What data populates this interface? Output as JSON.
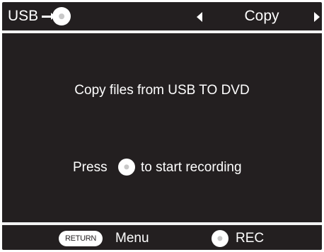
{
  "header": {
    "source_label": "USB",
    "source_icon": "usb-to-disc-arrow-icon",
    "mode_value": "Copy",
    "prev_icon": "triangle-left-icon",
    "next_icon": "triangle-right-icon"
  },
  "main": {
    "message": "Copy files from USB TO DVD",
    "instruction_prefix": "Press",
    "instruction_icon": "disc-button-icon",
    "instruction_suffix": "to start recording"
  },
  "footer": {
    "return_badge": "RETURN",
    "return_action": "Menu",
    "rec_icon": "disc-button-icon",
    "rec_action": "REC"
  },
  "colors": {
    "background": "#231f20",
    "foreground": "#ffffff",
    "divider": "#f2f2f2"
  }
}
